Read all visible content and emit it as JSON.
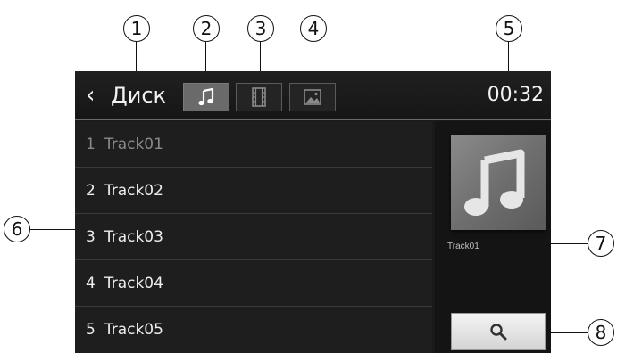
{
  "header": {
    "back_icon": "chevron-left-icon",
    "title": "Диск",
    "time": "00:32",
    "tabs": [
      {
        "icon": "music-note-icon",
        "active": true
      },
      {
        "icon": "film-icon",
        "active": false
      },
      {
        "icon": "image-icon",
        "active": false
      }
    ]
  },
  "tracks": [
    {
      "num": "1",
      "name": "Track01",
      "current": true
    },
    {
      "num": "2",
      "name": "Track02",
      "current": false
    },
    {
      "num": "3",
      "name": "Track03",
      "current": false
    },
    {
      "num": "4",
      "name": "Track04",
      "current": false
    },
    {
      "num": "5",
      "name": "Track05",
      "current": false
    }
  ],
  "sidebar": {
    "cover_icon": "music-note-icon",
    "cover_label": "Track01",
    "search_icon": "search-icon"
  },
  "callouts": [
    "1",
    "2",
    "3",
    "4",
    "5",
    "6",
    "7",
    "8"
  ],
  "colors": {
    "screen_bg": "#1a1a1a",
    "text": "#eeeeee",
    "dim_text": "#8a8a8a",
    "active_tab": "#6a6a6a"
  }
}
